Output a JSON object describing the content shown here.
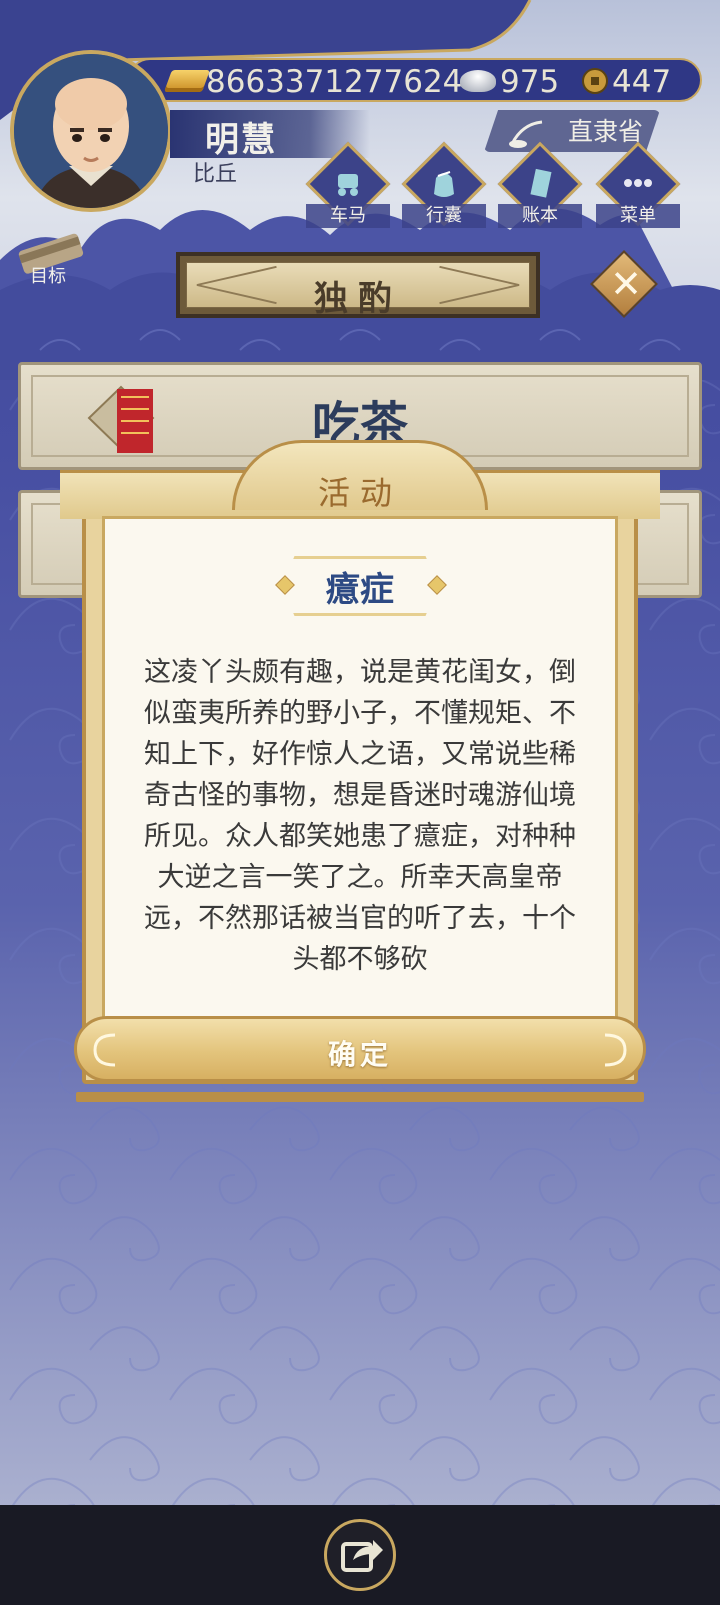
{
  "resources": {
    "gold": "8663371277624",
    "silver": "975",
    "coins": "447"
  },
  "player": {
    "name": "明慧",
    "rank": "比丘"
  },
  "location": "直隶省",
  "menu": [
    {
      "label": "车马",
      "icon": "carriage-icon"
    },
    {
      "label": "行囊",
      "icon": "bag-icon"
    },
    {
      "label": "账本",
      "icon": "ledger-icon"
    },
    {
      "label": "菜单",
      "icon": "more-icon"
    }
  ],
  "goal_label": "目标",
  "page_title": "独酌",
  "event": {
    "name": "吃茶"
  },
  "modal": {
    "header": "活动",
    "subtitle": "癔症",
    "body": "这凌丫头颇有趣，说是黄花闺女，倒似蛮夷所养的野小子，不懂规矩、不知上下，好作惊人之语，又常说些稀奇古怪的事物，想是昏迷时魂游仙境所见。众人都笑她患了癔症，对种种大逆之言一笑了之。所幸天高皇帝远，不然那话被当官的听了去，十个头都不够砍",
    "confirm": "确定"
  },
  "colors": {
    "background": "#474fa2",
    "accent_gold": "#c9a860",
    "panel_paper": "#fbf8ef",
    "title_blue": "#2d4a84"
  },
  "icons": {
    "close": "close-icon",
    "share": "share-icon"
  }
}
